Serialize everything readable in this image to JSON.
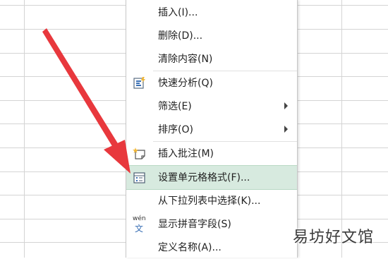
{
  "menu": {
    "items": [
      {
        "label": "插入(I)...",
        "icon": "",
        "submenu": false
      },
      {
        "label": "删除(D)...",
        "icon": "",
        "submenu": false
      },
      {
        "label": "清除内容(N)",
        "icon": "",
        "submenu": false
      },
      {
        "label": "快速分析(Q)",
        "icon": "quick-analysis-icon",
        "submenu": false
      },
      {
        "label": "筛选(E)",
        "icon": "",
        "submenu": true
      },
      {
        "label": "排序(O)",
        "icon": "",
        "submenu": true
      },
      {
        "label": "插入批注(M)",
        "icon": "insert-comment-icon",
        "submenu": false
      },
      {
        "label": "设置单元格格式(F)...",
        "icon": "format-cells-icon",
        "submenu": false,
        "highlighted": true
      },
      {
        "label": "从下拉列表中选择(K)...",
        "icon": "",
        "submenu": false
      },
      {
        "label": "显示拼音字段(S)",
        "icon": "phonetic-guide-icon",
        "submenu": false
      },
      {
        "label": "定义名称(A)...",
        "icon": "",
        "submenu": false
      }
    ]
  },
  "phonetic_icon_text": {
    "top": "wén",
    "bottom": "文"
  },
  "watermark": "易坊好文馆",
  "colors": {
    "highlight_bg": "#d7eadf",
    "arrow_red": "#e8383d",
    "grid_line": "#d4d4d4"
  }
}
